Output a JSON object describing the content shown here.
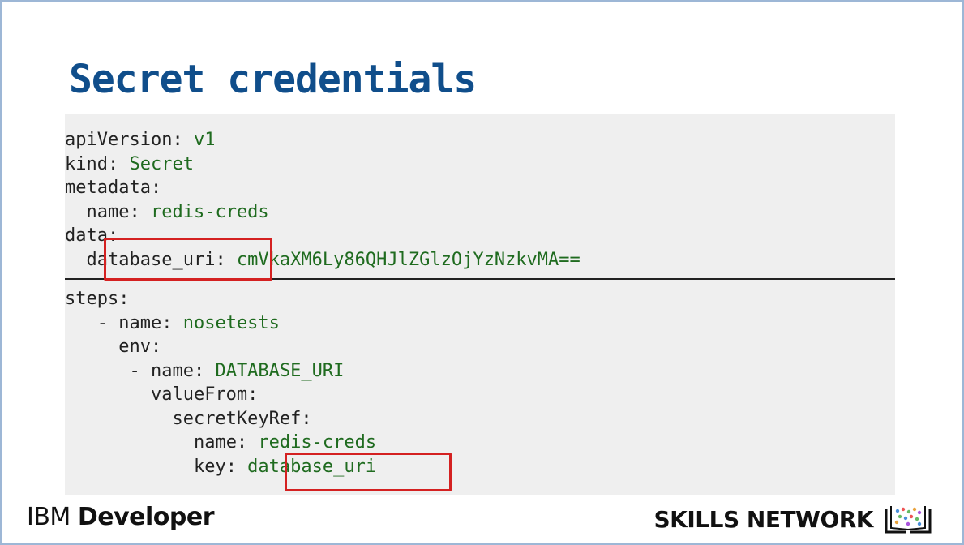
{
  "slide": {
    "title": "Secret credentials"
  },
  "code_top": [
    {
      "indent": "",
      "key": "apiVersion:",
      "value": " v1"
    },
    {
      "indent": "",
      "key": "kind:",
      "value": " Secret"
    },
    {
      "indent": "",
      "key": "metadata:",
      "value": ""
    },
    {
      "indent": "  ",
      "key": "name:",
      "value": " redis-creds"
    },
    {
      "indent": "",
      "key": "data:",
      "value": ""
    },
    {
      "indent": "  ",
      "key": "database_uri:",
      "value": " cmVkaXM6Ly86QHJlZGlzOjYzNzkvMA=="
    }
  ],
  "code_bottom": [
    {
      "indent": "",
      "key": "steps:",
      "value": ""
    },
    {
      "indent": "   - ",
      "key": "name:",
      "value": " nosetests"
    },
    {
      "indent": "     ",
      "key": "env:",
      "value": ""
    },
    {
      "indent": "      - ",
      "key": "name:",
      "value": " DATABASE_URI"
    },
    {
      "indent": "        ",
      "key": "valueFrom:",
      "value": ""
    },
    {
      "indent": "          ",
      "key": "secretKeyRef:",
      "value": ""
    },
    {
      "indent": "            ",
      "key": "name:",
      "value": " redis-creds"
    },
    {
      "indent": "            ",
      "key": "key:",
      "value": " database_uri"
    }
  ],
  "footer": {
    "brand_ibm": "IBM",
    "brand_developer": "Developer",
    "skills_network": "SKILLS NETWORK",
    "logo_icon": "book-icon"
  },
  "colors": {
    "title": "#104e8b",
    "code_value": "#1f6b1f",
    "highlight": "#d42121",
    "panel_bg": "#efefef"
  }
}
